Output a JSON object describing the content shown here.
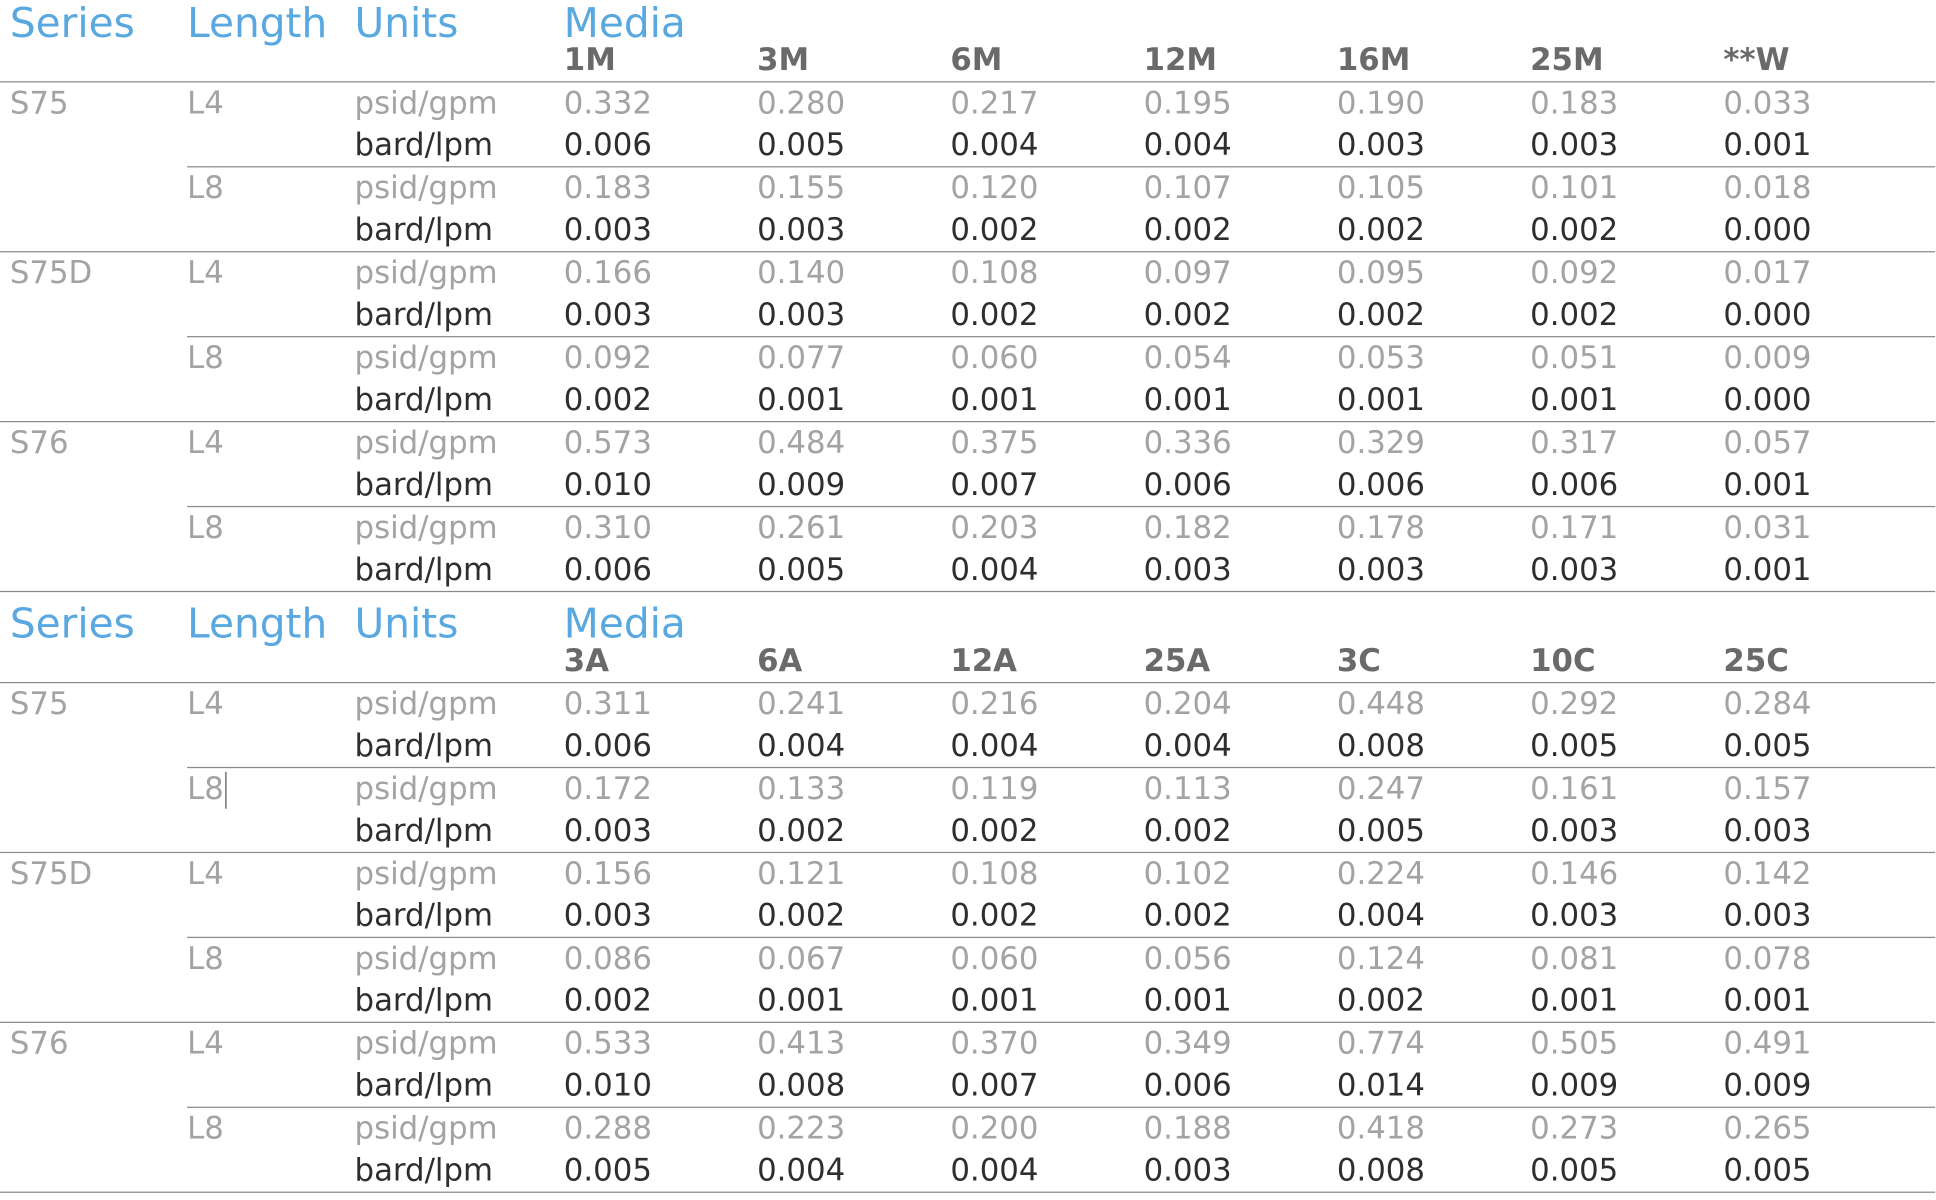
{
  "tables": [
    {
      "headers": {
        "series": "Series",
        "length": "Length",
        "units": "Units",
        "media": "Media"
      },
      "media_codes": [
        "1M",
        "3M",
        "6M",
        "12M",
        "16M",
        "25M",
        "**W"
      ],
      "groups": [
        {
          "series": "S75",
          "subgroups": [
            {
              "length": "L4",
              "psid_units": "psid/gpm",
              "psid": [
                "0.332",
                "0.280",
                "0.217",
                "0.195",
                "0.190",
                "0.183",
                "0.033"
              ],
              "bard_units": "bard/lpm",
              "bard": [
                "0.006",
                "0.005",
                "0.004",
                "0.004",
                "0.003",
                "0.003",
                "0.001"
              ]
            },
            {
              "length": "L8",
              "psid_units": "psid/gpm",
              "psid": [
                "0.183",
                "0.155",
                "0.120",
                "0.107",
                "0.105",
                "0.101",
                "0.018"
              ],
              "bard_units": "bard/lpm",
              "bard": [
                "0.003",
                "0.003",
                "0.002",
                "0.002",
                "0.002",
                "0.002",
                "0.000"
              ]
            }
          ]
        },
        {
          "series": "S75D",
          "subgroups": [
            {
              "length": "L4",
              "psid_units": "psid/gpm",
              "psid": [
                "0.166",
                "0.140",
                "0.108",
                "0.097",
                "0.095",
                "0.092",
                "0.017"
              ],
              "bard_units": "bard/lpm",
              "bard": [
                "0.003",
                "0.003",
                "0.002",
                "0.002",
                "0.002",
                "0.002",
                "0.000"
              ]
            },
            {
              "length": "L8",
              "psid_units": "psid/gpm",
              "psid": [
                "0.092",
                "0.077",
                "0.060",
                "0.054",
                "0.053",
                "0.051",
                "0.009"
              ],
              "bard_units": "bard/lpm",
              "bard": [
                "0.002",
                "0.001",
                "0.001",
                "0.001",
                "0.001",
                "0.001",
                "0.000"
              ]
            }
          ]
        },
        {
          "series": "S76",
          "subgroups": [
            {
              "length": "L4",
              "psid_units": "psid/gpm",
              "psid": [
                "0.573",
                "0.484",
                "0.375",
                "0.336",
                "0.329",
                "0.317",
                "0.057"
              ],
              "bard_units": "bard/lpm",
              "bard": [
                "0.010",
                "0.009",
                "0.007",
                "0.006",
                "0.006",
                "0.006",
                "0.001"
              ]
            },
            {
              "length": "L8",
              "psid_units": "psid/gpm",
              "psid": [
                "0.310",
                "0.261",
                "0.203",
                "0.182",
                "0.178",
                "0.171",
                "0.031"
              ],
              "bard_units": "bard/lpm",
              "bard": [
                "0.006",
                "0.005",
                "0.004",
                "0.003",
                "0.003",
                "0.003",
                "0.001"
              ]
            }
          ]
        }
      ]
    },
    {
      "headers": {
        "series": "Series",
        "length": "Length",
        "units": "Units",
        "media": "Media"
      },
      "media_codes": [
        "3A",
        "6A",
        "12A",
        "25A",
        "3C",
        "10C",
        "25C"
      ],
      "groups": [
        {
          "series": "S75",
          "subgroups": [
            {
              "length": "L4",
              "psid_units": "psid/gpm",
              "psid": [
                "0.311",
                "0.241",
                "0.216",
                "0.204",
                "0.448",
                "0.292",
                "0.284"
              ],
              "bard_units": "bard/lpm",
              "bard": [
                "0.006",
                "0.004",
                "0.004",
                "0.004",
                "0.008",
                "0.005",
                "0.005"
              ]
            },
            {
              "length": "L8",
              "psid_units": "psid/gpm",
              "psid": [
                "0.172",
                "0.133",
                "0.119",
                "0.113",
                "0.247",
                "0.161",
                "0.157"
              ],
              "bard_units": "bard/lpm",
              "bard": [
                "0.003",
                "0.002",
                "0.002",
                "0.002",
                "0.005",
                "0.003",
                "0.003"
              ]
            }
          ]
        },
        {
          "series": "S75D",
          "subgroups": [
            {
              "length": "L4",
              "psid_units": "psid/gpm",
              "psid": [
                "0.156",
                "0.121",
                "0.108",
                "0.102",
                "0.224",
                "0.146",
                "0.142"
              ],
              "bard_units": "bard/lpm",
              "bard": [
                "0.003",
                "0.002",
                "0.002",
                "0.002",
                "0.004",
                "0.003",
                "0.003"
              ]
            },
            {
              "length": "L8",
              "psid_units": "psid/gpm",
              "psid": [
                "0.086",
                "0.067",
                "0.060",
                "0.056",
                "0.124",
                "0.081",
                "0.078"
              ],
              "bard_units": "bard/lpm",
              "bard": [
                "0.002",
                "0.001",
                "0.001",
                "0.001",
                "0.002",
                "0.001",
                "0.001"
              ]
            }
          ]
        },
        {
          "series": "S76",
          "subgroups": [
            {
              "length": "L4",
              "psid_units": "psid/gpm",
              "psid": [
                "0.533",
                "0.413",
                "0.370",
                "0.349",
                "0.774",
                "0.505",
                "0.491"
              ],
              "bard_units": "bard/lpm",
              "bard": [
                "0.010",
                "0.008",
                "0.007",
                "0.006",
                "0.014",
                "0.009",
                "0.009"
              ]
            },
            {
              "length": "L8",
              "psid_units": "psid/gpm",
              "psid": [
                "0.288",
                "0.223",
                "0.200",
                "0.188",
                "0.418",
                "0.273",
                "0.265"
              ],
              "bard_units": "bard/lpm",
              "bard": [
                "0.005",
                "0.004",
                "0.004",
                "0.003",
                "0.008",
                "0.005",
                "0.005"
              ]
            }
          ]
        }
      ]
    }
  ]
}
